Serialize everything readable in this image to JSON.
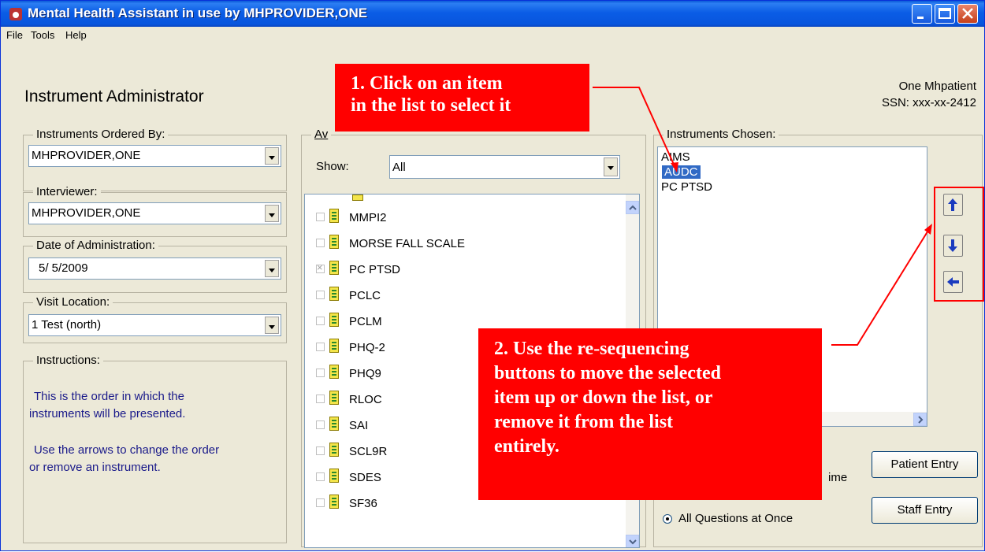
{
  "window": {
    "title": "Mental Health Assistant in use by MHPROVIDER,ONE"
  },
  "menu": [
    "File",
    "Tools",
    "Help"
  ],
  "header": {
    "title": "Instrument Administrator",
    "patient_name": "One Mhpatient",
    "ssn": "SSN: xxx-xx-2412"
  },
  "ordered_by": {
    "label": "Instruments Ordered By:",
    "value": "MHPROVIDER,ONE"
  },
  "interviewer": {
    "label": "Interviewer:",
    "value": "MHPROVIDER,ONE"
  },
  "date": {
    "label": "Date of Administration:",
    "value": "5/ 5/2009"
  },
  "location": {
    "label": "Visit Location:",
    "value": "1 Test (north)"
  },
  "instructions": {
    "label": "Instructions:",
    "line1": " This is the order in which the",
    "line2": "instruments will be presented.",
    "line3": " Use the arrows to change the order",
    "line4": "or remove an instrument."
  },
  "available": {
    "label": "Av",
    "show_label": "Show:",
    "show_value": "All",
    "items": [
      {
        "label": "MMPI2",
        "checked": false
      },
      {
        "label": "MORSE FALL SCALE",
        "checked": false
      },
      {
        "label": "PC PTSD",
        "checked": true
      },
      {
        "label": "PCLC",
        "checked": false
      },
      {
        "label": "PCLM",
        "checked": false
      },
      {
        "label": "PHQ-2",
        "checked": false
      },
      {
        "label": "PHQ9",
        "checked": false
      },
      {
        "label": "RLOC",
        "checked": false
      },
      {
        "label": "SAI",
        "checked": false
      },
      {
        "label": "SCL9R",
        "checked": false
      },
      {
        "label": "SDES",
        "checked": false
      },
      {
        "label": "SF36",
        "checked": false
      }
    ]
  },
  "chosen": {
    "label": "Instruments Chosen:",
    "items": [
      "AIMS",
      "AUDC",
      "PC PTSD"
    ],
    "selected": "AUDC"
  },
  "mode": {
    "option_time": "ime",
    "option_all": "All Questions at Once"
  },
  "buttons": {
    "patient_entry": "Patient Entry",
    "staff_entry": "Staff Entry"
  },
  "callouts": {
    "c1_line1": "1. Click on an item",
    "c1_line2": "in the list to select it",
    "c2_line1": "2. Use the re-sequencing",
    "c2_line2": "buttons to move the selected",
    "c2_line3": "item up or down the list, or",
    "c2_line4": "remove it from the list",
    "c2_line5": "entirely."
  },
  "colors": {
    "titlebar": "#0a5ad8",
    "callout": "#ff0000",
    "selection": "#316ac5"
  }
}
